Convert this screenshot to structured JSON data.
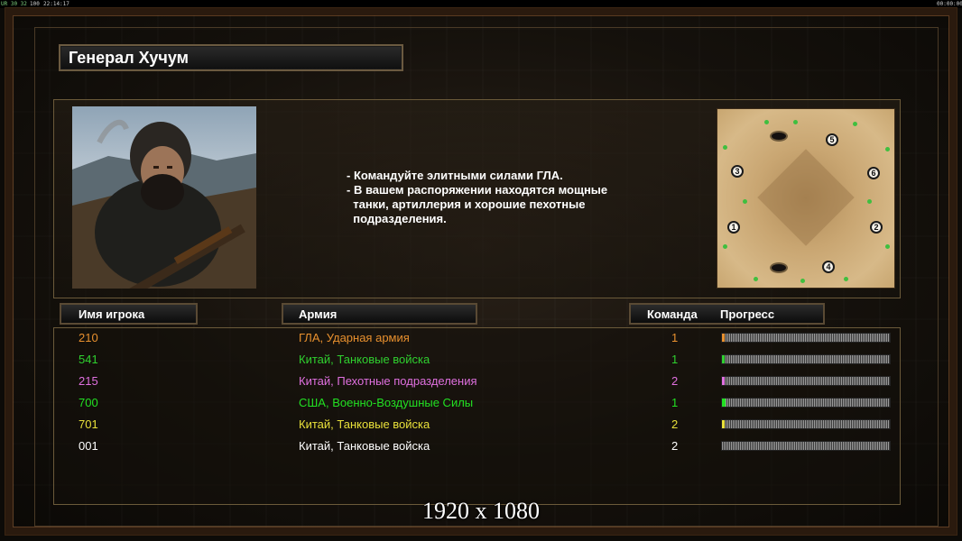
{
  "topbar": {
    "left": "UR 30 32",
    "mid": "100",
    "time": "22:14:17",
    "right": "00:00:00"
  },
  "general": {
    "title": "Генерал Хучум"
  },
  "description": [
    "- Командуйте элитными силами ГЛА.",
    "- В вашем распоряжении находятся мощные",
    "  танки, артиллерия и хорошие пехотные",
    "  подразделения."
  ],
  "minimap": {
    "spawns": [
      "1",
      "2",
      "3",
      "4",
      "5",
      "6"
    ]
  },
  "table": {
    "headers": {
      "player": "Имя игрока",
      "army": "Армия",
      "team": "Команда",
      "progress": "Прогресс"
    },
    "rows": [
      {
        "name": "210",
        "army": "ГЛА, Ударная армия",
        "team": "1",
        "color": "#e8902e",
        "progress": 0.01
      },
      {
        "name": "541",
        "army": "Китай, Танковые войска",
        "team": "1",
        "color": "#2fd02f",
        "progress": 0.01
      },
      {
        "name": "215",
        "army": "Китай, Пехотные подразделения",
        "team": "2",
        "color": "#e070e0",
        "progress": 0.01
      },
      {
        "name": "700",
        "army": "США, Военно-Воздушные Силы",
        "team": "1",
        "color": "#22e022",
        "progress": 0.02
      },
      {
        "name": "701",
        "army": "Китай, Танковые войска",
        "team": "2",
        "color": "#e8e03a",
        "progress": 0.01
      },
      {
        "name": "001",
        "army": "Китай, Танковые войска",
        "team": "2",
        "color": "#ffffff",
        "progress": 0.0
      }
    ]
  },
  "resolution_label": "1920 x 1080"
}
